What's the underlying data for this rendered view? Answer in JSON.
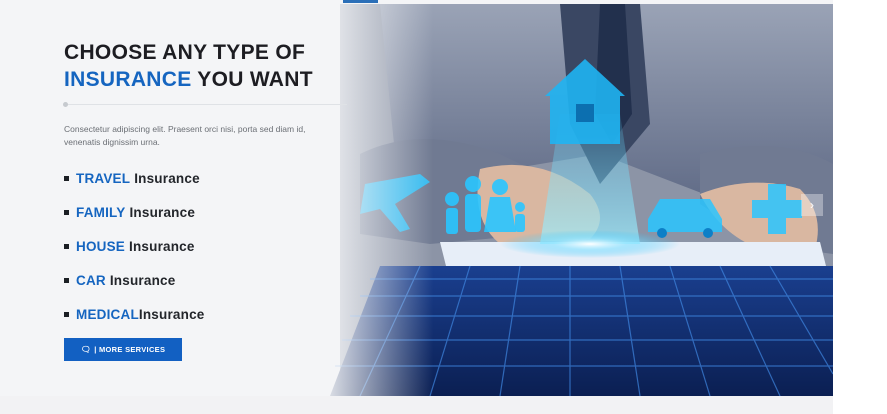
{
  "hero": {
    "headline_line1": "CHOOSE ANY TYPE OF",
    "headline_highlight": "INSURANCE",
    "headline_rest": " YOU WANT",
    "description": "Consectetur adipiscing elit. Praesent orci nisi, porta sed diam id, venenatis dignissim urna."
  },
  "insurance_types": [
    {
      "type": "TRAVEL",
      "label": "Insurance",
      "spaced": true
    },
    {
      "type": "FAMILY",
      "label": "Insurance",
      "spaced": true
    },
    {
      "type": "HOUSE",
      "label": "Insurance",
      "spaced": true
    },
    {
      "type": "CAR",
      "label": "Insurance",
      "spaced": true
    },
    {
      "type": "MEDICAL",
      "label": "Insurance",
      "spaced": false
    }
  ],
  "button": {
    "icon": "comments-icon",
    "icon_glyph": "🗨",
    "label": "| MORE SERVICES"
  },
  "slider": {
    "next_icon": "chevron-right-icon",
    "next_glyph": "›"
  },
  "colors": {
    "accent": "#1565c0",
    "button": "#1260c2",
    "heading": "#1d1d22",
    "holo": "#29c5ff"
  }
}
